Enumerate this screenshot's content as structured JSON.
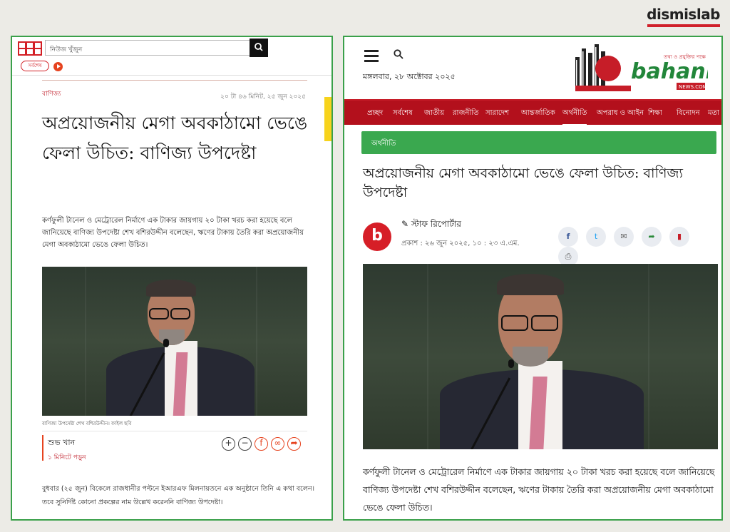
{
  "brand": "dismislab",
  "left": {
    "search_placeholder": "নিউজ খুঁজুন",
    "chip": "সর্বশেষ",
    "category": "বাণিজ্য",
    "date": "২০ টা ৪৬ মিনিট, ২৫ জুন ২০২৫",
    "title": "অপ্রয়োজনীয় মেগা অবকাঠামো ভেঙে ফেলা উচিত: বাণিজ্য উপদেষ্টা",
    "lead": "কর্ণফুলী টানেল ও মেট্রোরেল নির্মাণে এক টাকার জায়গায় ২০ টাকা খরচ করা হয়েছে বলে জানিয়েছে বাণিজ্য উপদেষ্টা শেখ বশিরউদ্দীন বলেছেন, ঋণের টাকায় তৈরি করা অপ্রয়োজনীয় মেগা অবকাঠামো ভেঙে ফেলা উচিত।",
    "caption": "বাণিজ্য উপদেষ্টা শেখ বশিরউদ্দীন। ফাইল ছবি",
    "author": "শুভ খান",
    "read_time": "১ মিনিটে পড়ুন",
    "body": "বুধবার (২৫ জুন) বিকেলে রাজধানীর পল্টনে ইআরএফ মিলনায়তনে এক অনুষ্ঠানে তিনি এ কথা বলেন। তবে সুনির্দিষ্ট কোনো প্রকল্পের নাম উল্লেখ করেননি বাণিজ্য উপদেষ্টা।"
  },
  "right": {
    "date": "মঙ্গলবার, ২৮ অক্টোবর ২০২৫",
    "logo_text": "bahanno",
    "logo_tag": "তথ্য ও প্রযুক্তির পক্ষে",
    "logo_sub": "NEWS.COM",
    "nav": [
      "প্রচ্ছদ",
      "সর্বশেষ",
      "জাতীয়",
      "রাজনীতি",
      "সারাদেশ",
      "আন্তর্জাতিক",
      "অর্থনীতি",
      "অপরাধ ও আইন",
      "শিক্ষা",
      "বিনোদন",
      "মতা"
    ],
    "category": "অর্থনীতি",
    "title": "অপ্রয়োজনীয় মেগা অবকাঠামো ভেঙে ফেলা উচিত: বাণিজ্য উপদেষ্টা",
    "author": "স্টাফ রিপোর্টার",
    "published": "প্রকাশ : ২৬ জুন ২০২৫, ১০ : ২৩ এ.এম.",
    "avatar": "b",
    "body": "কর্ণফুলী টানেল ও মেট্রোরেল নির্মাণে এক টাকার জায়গায় ২০ টাকা খরচ করা হয়েছে বলে জানিয়েছে বাণিজ্য উপদেষ্টা শেখ বশিরউদ্দীন বলেছেন, ঋণের টাকায় তৈরি করা অপ্রয়োজনীয় মেগা অবকাঠামো ভেঙে ফেলা উচিত।"
  },
  "colors": {
    "green": "#3aa04a",
    "red": "#b3101c",
    "accent": "#e6431f"
  },
  "icons": [
    "search-icon",
    "play-icon",
    "plus-icon",
    "minus-icon",
    "facebook-icon",
    "link-icon",
    "share-icon",
    "menu-icon",
    "twitter-icon",
    "mail-icon",
    "bookmark-icon",
    "print-icon",
    "pen-icon"
  ]
}
